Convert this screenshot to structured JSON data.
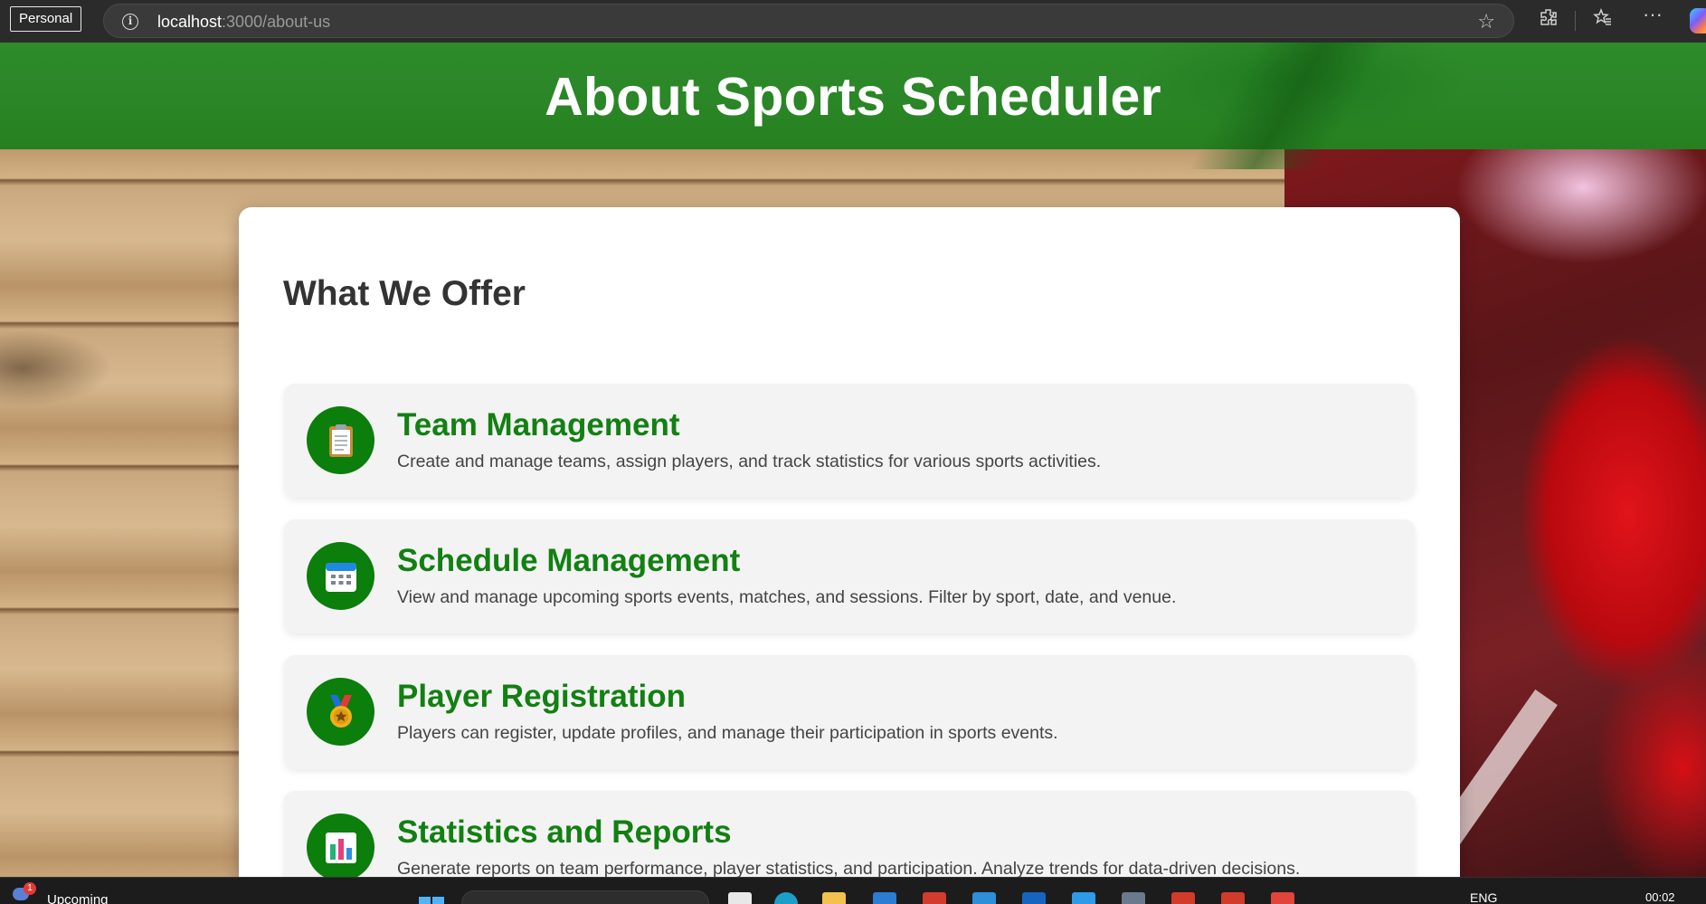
{
  "browser": {
    "profile_label": "Personal",
    "url_host": "localhost",
    "url_path": ":3000/about-us"
  },
  "hero": {
    "title": "About Sports Scheduler"
  },
  "section": {
    "heading": "What We Offer"
  },
  "features": [
    {
      "icon": "clipboard-icon",
      "title": "Team Management",
      "description": "Create and manage teams, assign players, and track statistics for various sports activities."
    },
    {
      "icon": "calendar-icon",
      "title": "Schedule Management",
      "description": "View and manage upcoming sports events, matches, and sessions. Filter by sport, date, and venue."
    },
    {
      "icon": "medal-icon",
      "title": "Player Registration",
      "description": "Players can register, update profiles, and manage their participation in sports events."
    },
    {
      "icon": "bar-chart-icon",
      "title": "Statistics and Reports",
      "description": "Generate reports on team performance, player statistics, and participation. Analyze trends for data-driven decisions."
    }
  ],
  "taskbar": {
    "weather_badge": "1",
    "widget_label": "Upcoming",
    "language": "ENG",
    "time": "00:02"
  },
  "colors": {
    "accent_green": "#128012",
    "icon_circle": "#0b7e0b",
    "hero_green": "#2a8626"
  }
}
